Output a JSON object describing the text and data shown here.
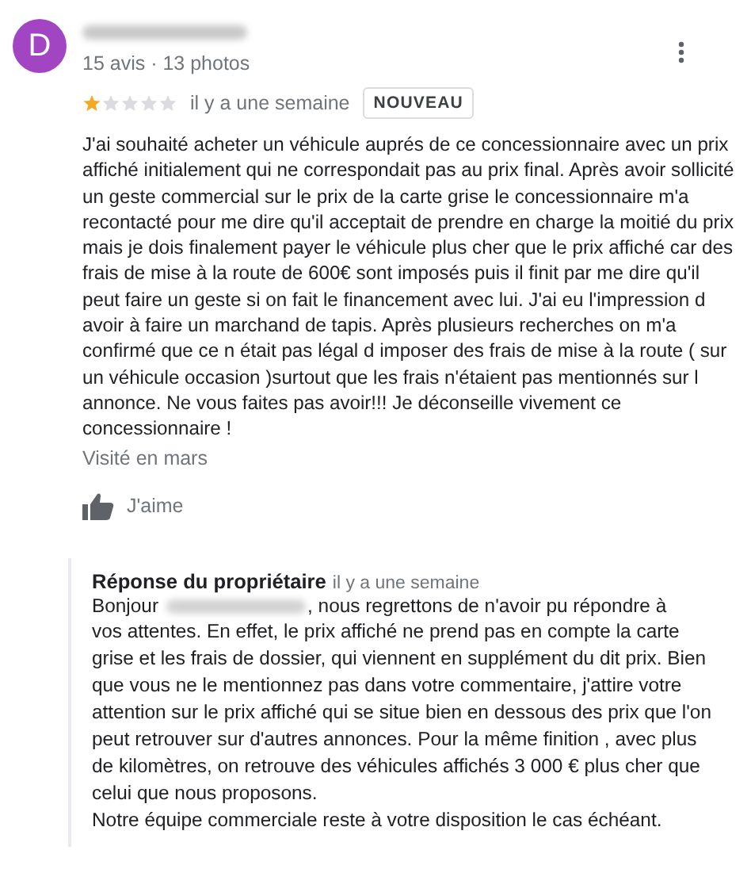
{
  "review": {
    "avatar_letter": "D",
    "author_stats": "15 avis · 13 photos",
    "stars": 1,
    "time": "il y a une semaine",
    "badge": "NOUVEAU",
    "text": "J'ai souhaité acheter un véhicule auprés de ce concessionnaire avec un prix affiché initialement qui ne correspondait pas au prix final. Après avoir sollicité un geste commercial sur le prix de la carte grise le concessionnaire m'a recontacté pour me dire qu'il acceptait de prendre en charge la moitié du prix mais je dois finalement payer le véhicule plus cher que le prix affiché car des frais de mise à la route de 600€ sont imposés puis il finit par me dire qu'il peut faire un geste si on fait le financement avec lui. J'ai eu l'impression d avoir à faire un marchand de tapis. Après plusieurs recherches on m'a confirmé que ce n était pas légal d imposer des frais de mise à la route ( sur un véhicule occasion )surtout que les frais n'étaient pas mentionnés sur l annonce. Ne vous faites pas avoir!!! Je déconseille vivement ce concessionnaire !",
    "visited": "Visité en mars",
    "like_label": "J'aime"
  },
  "owner_reply": {
    "title": "Réponse du propriétaire",
    "time": "il y a une semaine",
    "greeting": "Bonjour",
    "text_first_line": ", nous regrettons de n'avoir pu répondre à",
    "text": "vos attentes. En effet, le prix affiché ne prend pas en compte la carte grise et les frais de dossier, qui viennent en supplément du dit prix. Bien que vous ne le mentionnez pas dans votre commentaire, j'attire votre attention sur le prix affiché qui se situe bien en dessous des prix que l'on peut retrouver sur d'autres annonces. Pour la même finition , avec plus de kilomètres, on retrouve des véhicules affichés 3 000 € plus cher que celui que nous proposons.",
    "closing": "Notre équipe commerciale reste à votre disposition le cas échéant."
  }
}
